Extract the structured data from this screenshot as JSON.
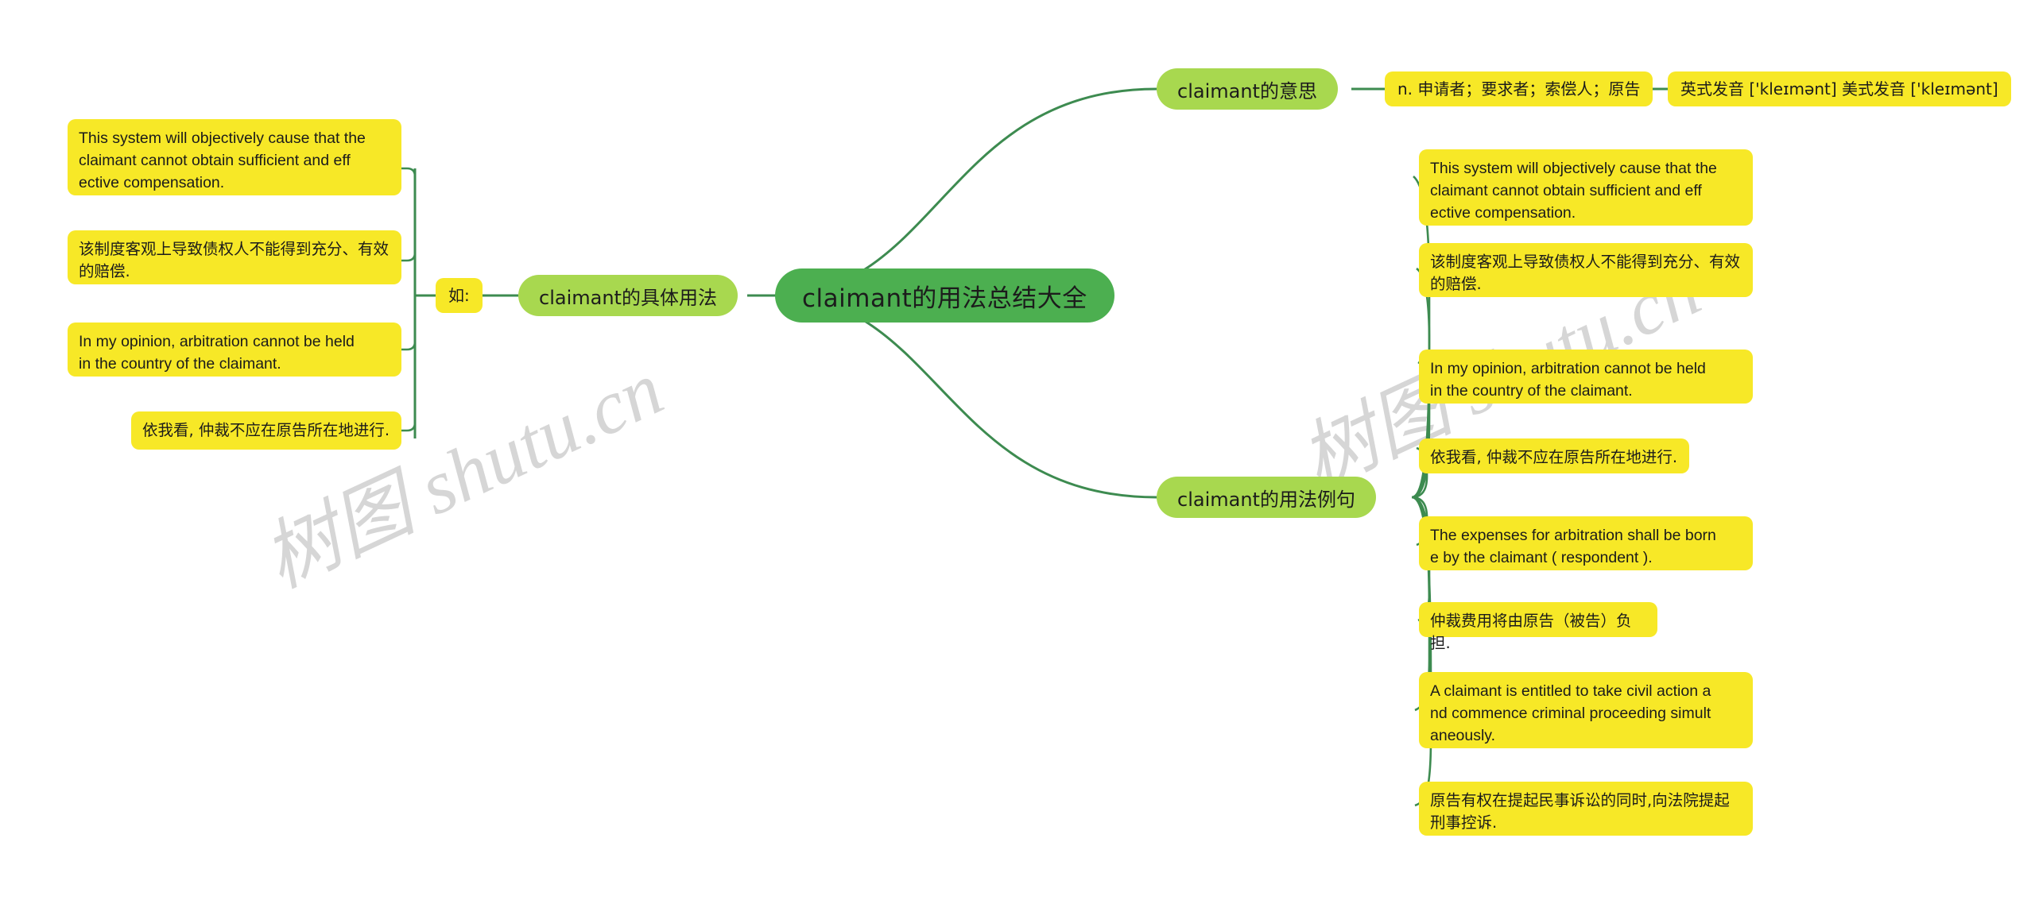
{
  "watermark": {
    "text": "树图 shutu.cn"
  },
  "root": {
    "label": "claimant的用法总结大全",
    "color": "#4caf50"
  },
  "colors": {
    "root_green": "#4caf50",
    "branch_green": "#a8d84f",
    "leaf_yellow": "#f7e827",
    "connector_green": "#3d8b50",
    "text_dark": "#1b1b1b",
    "watermark_gray": "#d6d6d6",
    "background": "#ffffff"
  },
  "branches": [
    {
      "id": "meaning",
      "label": "claimant的意思",
      "side": "right",
      "children": [
        {
          "id": "definition",
          "label": "n. 申请者；要求者；索偿人；原告"
        },
        {
          "id": "pronunciation",
          "label": "英式发音 ['kleɪmənt] 美式发音 ['kleɪmənt]"
        }
      ]
    },
    {
      "id": "usage",
      "label": "claimant的具体用法",
      "side": "left",
      "connector_label": "如:",
      "children": [
        {
          "id": "usage-en-1",
          "label": "This system will objectively cause that the claimant cannot obtain sufficient and effective compensation."
        },
        {
          "id": "usage-zh-1",
          "label": "该制度客观上导致债权人不能得到充分、有效的赔偿."
        },
        {
          "id": "usage-en-2",
          "label": "In my opinion, arbitration cannot be held in the country of the claimant."
        },
        {
          "id": "usage-zh-2",
          "label": "依我看, 仲裁不应在原告所在地进行."
        }
      ]
    },
    {
      "id": "examples",
      "label": "claimant的用法例句",
      "side": "right",
      "children": [
        {
          "id": "ex-en-1",
          "label": "This system will objectively cause the claimant cannot obtain sufficient and effective compensation."
        },
        {
          "id": "ex-zh-1",
          "label": "该制度客观上导致债权人不能得到充分、有效的赔偿."
        },
        {
          "id": "ex-en-2",
          "label": "In my opinion, arbitration cannot be held in the country of the claimant."
        },
        {
          "id": "ex-zh-2",
          "label": "依我看, 仲裁不应在原告所在地进行."
        },
        {
          "id": "ex-en-3",
          "label": "The expenses for arbitration shall be borne by the claimant ( respondent )."
        },
        {
          "id": "ex-zh-3",
          "label": "仲裁费用将由原告（被告）负担."
        },
        {
          "id": "ex-en-4",
          "label": "A claimant is entitled to take civil action and commence criminal proceeding simultaneously."
        },
        {
          "id": "ex-zh-4",
          "label": "原告有权在提起民事诉讼的同时,向法院提起刑事控诉."
        }
      ]
    }
  ],
  "left_leaf_lines": {
    "l1": [
      "This system will objectively cause that the",
      " claimant cannot obtain sufficient and eff",
      "ective compensation."
    ],
    "l2": [
      "该制度客观上导致债权人不能得到充分、有效",
      "的赔偿."
    ],
    "l3": [
      "In my opinion, arbitration cannot be held",
      "in the country of the claimant."
    ],
    "l4": [
      "依我看, 仲裁不应在原告所在地进行."
    ]
  },
  "right_leaf_lines": {
    "r1": [
      "This system will objectively cause that the",
      " claimant cannot obtain sufficient and eff",
      "ective compensation."
    ],
    "r2": [
      "该制度客观上导致债权人不能得到充分、有效",
      "的赔偿."
    ],
    "r3": [
      "In my opinion, arbitration cannot be held",
      "in the country of the claimant."
    ],
    "r4": [
      "依我看, 仲裁不应在原告所在地进行."
    ],
    "r5": [
      "The expenses for arbitration shall be born",
      "e by the claimant ( respondent )."
    ],
    "r6": [
      "仲裁费用将由原告（被告）负担."
    ],
    "r7": [
      "A claimant is entitled to take civil action a",
      "nd commence criminal proceeding simult",
      "aneously."
    ],
    "r8": [
      "原告有权在提起民事诉讼的同时,向法院提起",
      "刑事控诉."
    ]
  }
}
